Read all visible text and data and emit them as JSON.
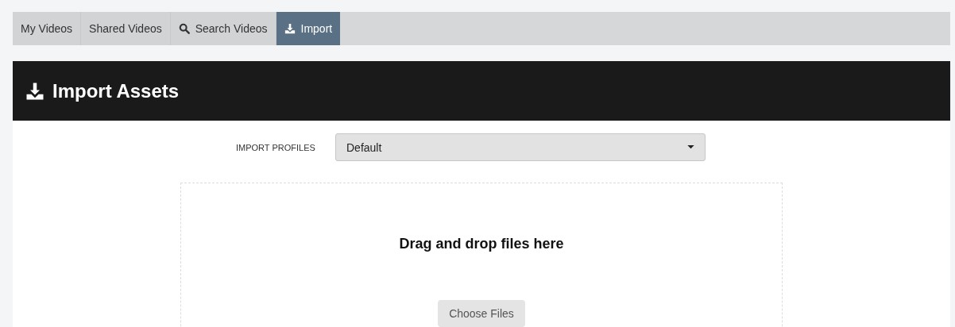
{
  "tabs": [
    {
      "label": "My Videos",
      "kind": "plain",
      "selected": false
    },
    {
      "label": "Shared Videos",
      "kind": "plain",
      "selected": false
    },
    {
      "label": "Search Videos",
      "kind": "search",
      "selected": false
    },
    {
      "label": "Import",
      "kind": "import",
      "selected": true
    }
  ],
  "header": {
    "title": "Import Assets"
  },
  "import_profiles": {
    "label": "IMPORT PROFILES",
    "value": "Default"
  },
  "dropzone": {
    "heading": "Drag and drop files here",
    "button": "Choose Files"
  }
}
